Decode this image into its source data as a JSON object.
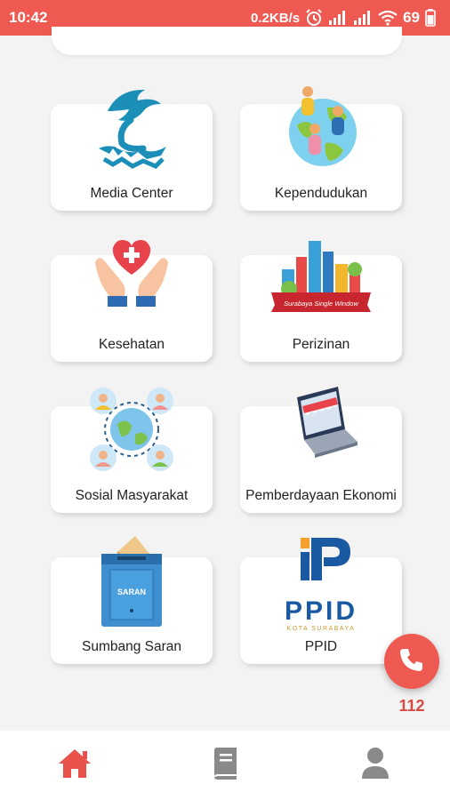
{
  "status_bar": {
    "time": "10:42",
    "net_speed": "0.2KB/s",
    "battery": "69",
    "icons": [
      "alarm-icon",
      "signal-icon",
      "signal-icon",
      "wifi-icon",
      "battery-icon"
    ]
  },
  "menu": {
    "items": [
      {
        "label": "Media Center",
        "icon": "crocodile-shark-logo-icon"
      },
      {
        "label": "Kependudukan",
        "icon": "globe-people-icon"
      },
      {
        "label": "Kesehatan",
        "icon": "hands-heart-icon"
      },
      {
        "label": "Perizinan",
        "icon": "city-skyline-icon",
        "icon_text": "Surabaya Single Window"
      },
      {
        "label": "Sosial Masyarakat",
        "icon": "community-network-icon"
      },
      {
        "label": "Pemberdayaan Ekonomi",
        "icon": "laptop-shop-icon"
      },
      {
        "label": "Sumbang Saran",
        "icon": "suggestion-box-icon",
        "icon_text": "SARAN"
      },
      {
        "label": "PPID",
        "icon": "ppid-logo-icon",
        "icon_text": "PPID",
        "icon_subtext": "KOTA SURABAYA"
      }
    ]
  },
  "emergency": {
    "label": "112",
    "icon": "phone-icon"
  },
  "bottom_nav": {
    "items": [
      {
        "icon": "home-icon",
        "active": true
      },
      {
        "icon": "book-icon",
        "active": false
      },
      {
        "icon": "user-icon",
        "active": false
      }
    ]
  },
  "colors": {
    "accent": "#ee5a52",
    "active_nav": "#e8524a",
    "inactive_nav": "#8a8a8a"
  }
}
